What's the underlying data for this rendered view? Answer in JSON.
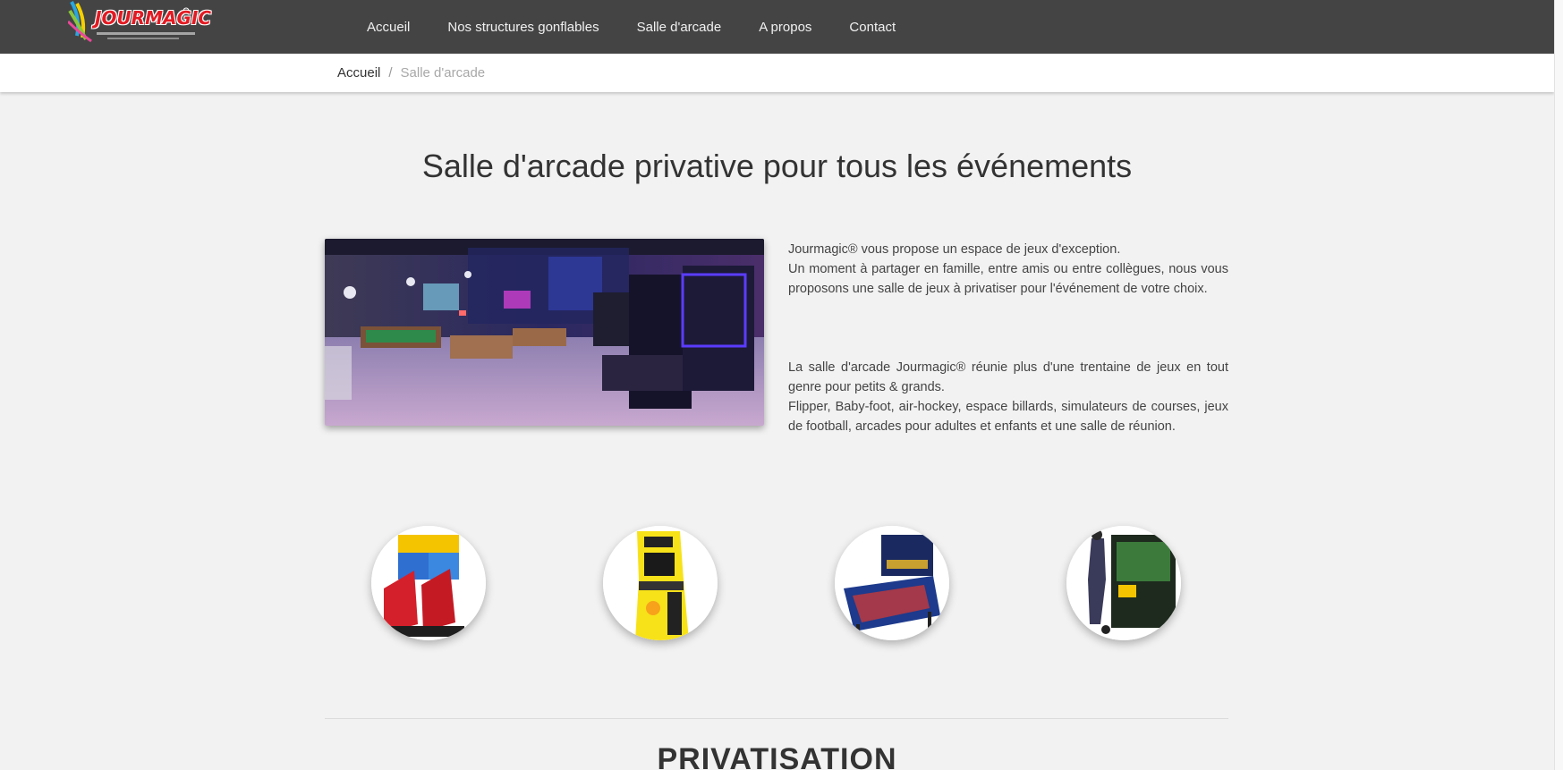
{
  "brand": {
    "logo_text": "JOURMAGIC"
  },
  "nav": {
    "items": [
      {
        "label": "Accueil"
      },
      {
        "label": "Nos structures gonflables"
      },
      {
        "label": "Salle d'arcade"
      },
      {
        "label": "A propos"
      },
      {
        "label": "Contact"
      }
    ]
  },
  "breadcrumb": {
    "home": "Accueil",
    "separator": "/",
    "current": "Salle d'arcade"
  },
  "main": {
    "title": "Salle d'arcade privative pour tous les événements",
    "intro": {
      "p1_line1": "Jourmagic® vous propose un espace de jeux d'exception.",
      "p1_line2": "Un moment à partager en famille, entre amis ou entre collègues, nous vous proposons une salle de jeux à privatiser pour l'événement de votre choix.",
      "p2_line1": "La salle d'arcade Jourmagic® réunie plus d'une trentaine de jeux en tout genre pour petits & grands.",
      "p2_line2": "Flipper, Baby-foot, air-hockey, espace billards, simulateurs de courses, jeux de football, arcades pour adultes et enfants et une salle de réunion."
    },
    "games": [
      {
        "icon": "racing-simulator-image"
      },
      {
        "icon": "arcade-cabinet-image"
      },
      {
        "icon": "pinball-machine-image"
      },
      {
        "icon": "football-arcade-image"
      }
    ]
  },
  "section": {
    "title": "PRIVATISATION"
  },
  "colors": {
    "navbar_bg": "#444444",
    "page_bg": "#f2f2f2",
    "logo_red": "#e21b23"
  }
}
